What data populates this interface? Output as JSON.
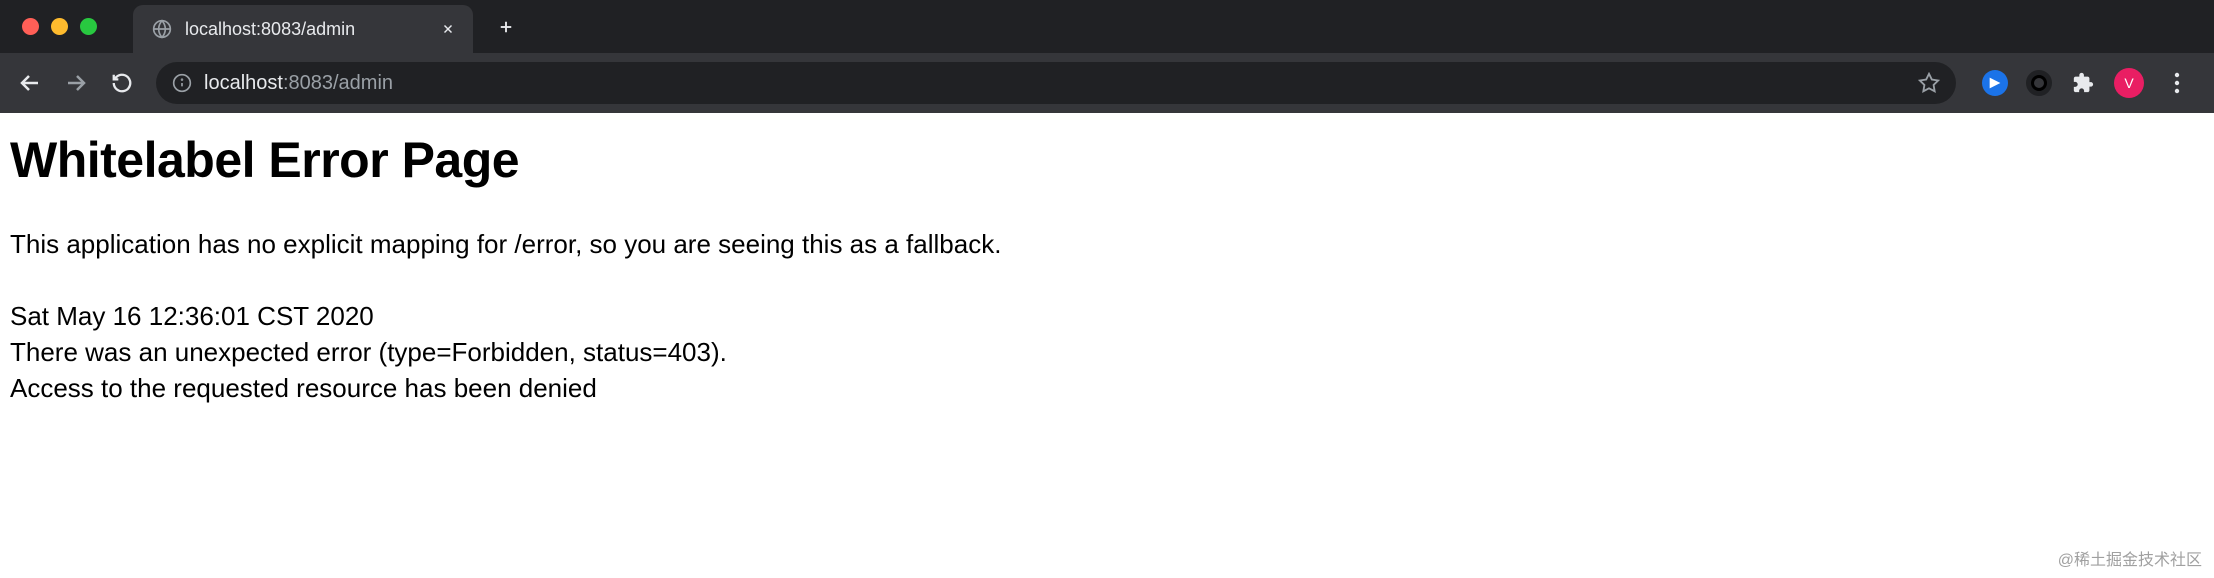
{
  "tab": {
    "title": "localhost:8083/admin"
  },
  "address": {
    "host": "localhost",
    "rest": ":8083/admin"
  },
  "avatar": {
    "letter": "V"
  },
  "page": {
    "heading": "Whitelabel Error Page",
    "fallback_msg": "This application has no explicit mapping for /error, so you are seeing this as a fallback.",
    "timestamp": "Sat May 16 12:36:01 CST 2020",
    "error_line": "There was an unexpected error (type=Forbidden, status=403).",
    "denied_msg": "Access to the requested resource has been denied"
  },
  "watermark": "@稀土掘金技术社区"
}
